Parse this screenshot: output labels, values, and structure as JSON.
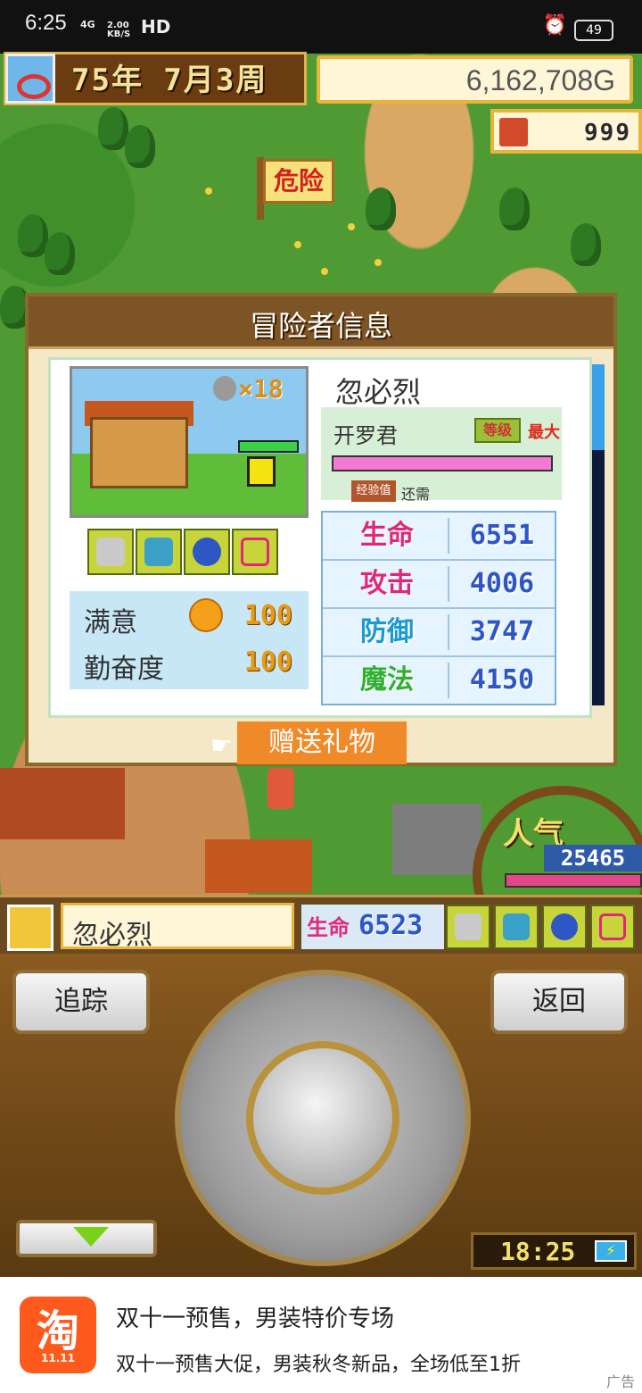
{
  "status_bar": {
    "time": "6:25",
    "network": "4G",
    "speed": "2.00\nKB/S",
    "hd": "HD",
    "battery": "49"
  },
  "hud": {
    "date": "75年 7月3周",
    "money": "6,162,708G",
    "population": "999",
    "flag_text": "危险"
  },
  "dialog": {
    "title": "冒险者信息",
    "portrait_badge_count": "×18",
    "adventurer_name": "忽必烈",
    "class_name": "开罗君",
    "level_badge": "等级",
    "level_value": "最大",
    "exp_label": "经验值",
    "exp_text": "还需",
    "satisfaction_label": "满意",
    "satisfaction_value": "100",
    "diligence_label": "勤奋度",
    "diligence_value": "100",
    "stats": [
      {
        "label": "生命",
        "value": "6551",
        "color": "#e0287a"
      },
      {
        "label": "攻击",
        "value": "4006",
        "color": "#e0287a"
      },
      {
        "label": "防御",
        "value": "3747",
        "color": "#1a9ad0"
      },
      {
        "label": "魔法",
        "value": "4150",
        "color": "#32b032"
      }
    ],
    "gift_button": "赠送礼物"
  },
  "popularity": {
    "label": "人气",
    "value": "25465"
  },
  "hero_strip": {
    "name": "忽必烈",
    "hp_label": "生命",
    "hp_value": "6523"
  },
  "controls": {
    "track_button": "追踪",
    "back_button": "返回",
    "clock": "18:25"
  },
  "ad": {
    "logo": "淘",
    "logo_sub": "11.11",
    "title": "双十一预售，男装特价专场",
    "description": "双十一预售大促，男装秋冬新品，全场低至1折",
    "tag": "广告"
  }
}
